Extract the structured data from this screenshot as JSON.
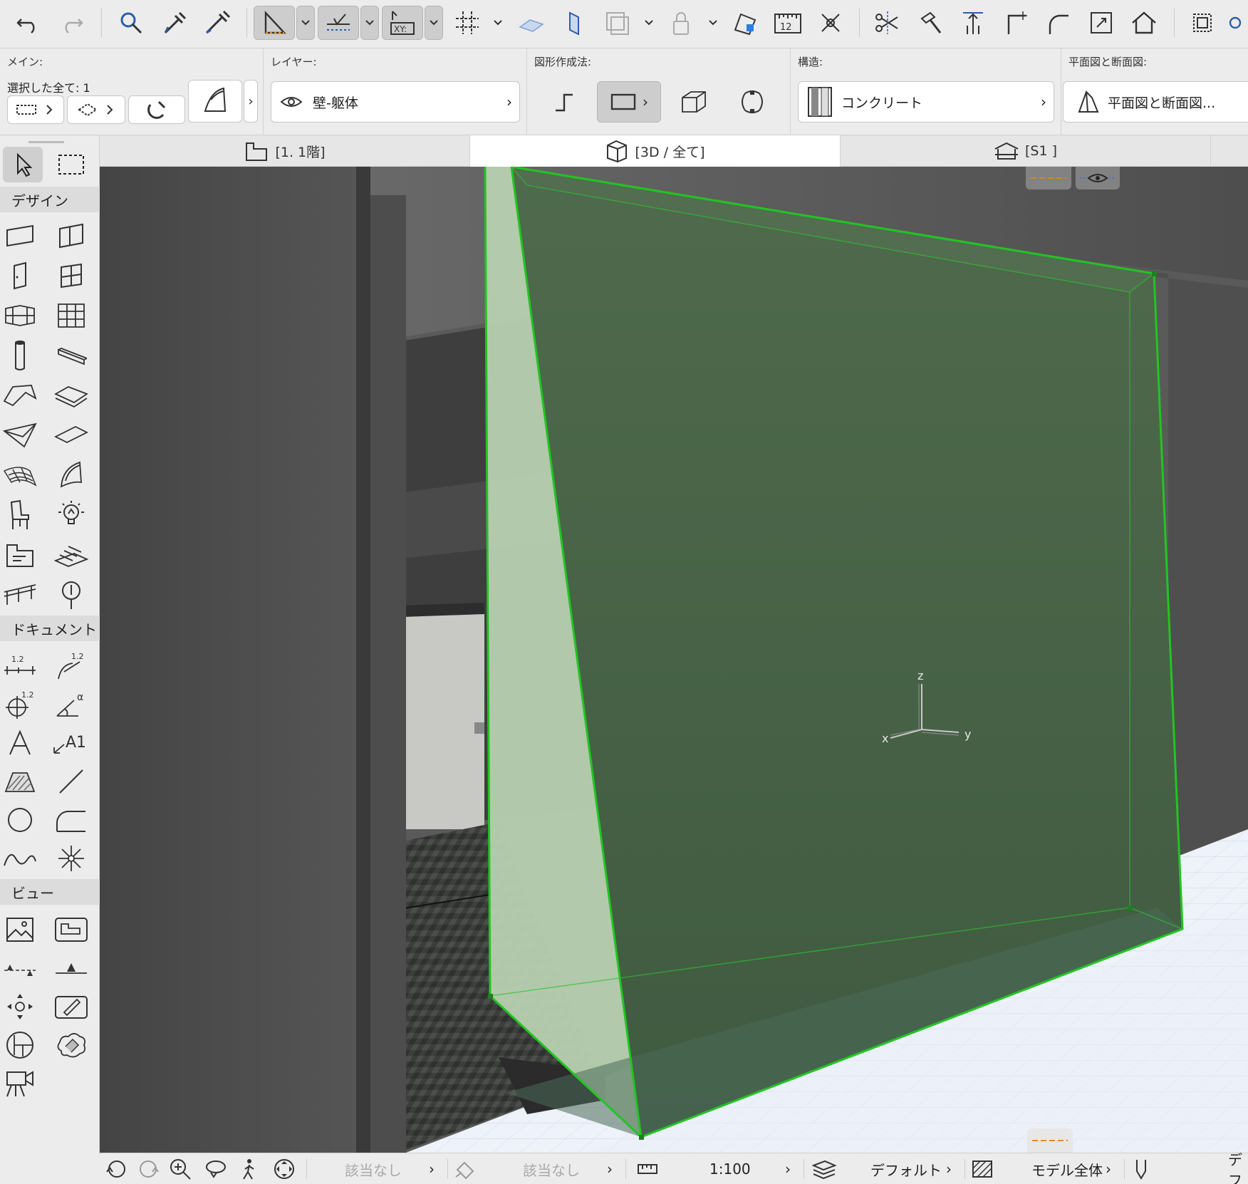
{
  "infobox": {
    "main_label": "メイン:",
    "selection_label": "選択した全て: 1",
    "layer_label": "レイヤー:",
    "layer_value": "壁-躯体",
    "geometry_label": "図形作成法:",
    "structure_label": "構造:",
    "structure_value": "コンクリート",
    "floorplan_label": "平面図と断面図:",
    "floorplan_value": "平面図と断面図..."
  },
  "tabs": [
    {
      "label": "[1. 1階]",
      "active": false,
      "icon": "floor-plan-icon"
    },
    {
      "label": "[3D / 全て]",
      "active": true,
      "icon": "3d-box-icon"
    },
    {
      "label": "[S1 ]",
      "active": false,
      "icon": "section-icon"
    }
  ],
  "toolbox": {
    "design_group": "デザイン",
    "document_group": "ドキュメント",
    "view_group": "ビュー"
  },
  "viewport": {
    "axis_labels": {
      "x": "x",
      "y": "y",
      "z": "z"
    },
    "selection_color": "#1fbf1f",
    "wall_color": "#4a6248"
  },
  "statusbar": {
    "undo_view_label": "",
    "layer_combo_1": "該当なし",
    "layer_combo_2": "該当なし",
    "scale": "1:100",
    "pen_set": "デフォルト",
    "model_view": "モデル全体",
    "last": "デフ"
  }
}
